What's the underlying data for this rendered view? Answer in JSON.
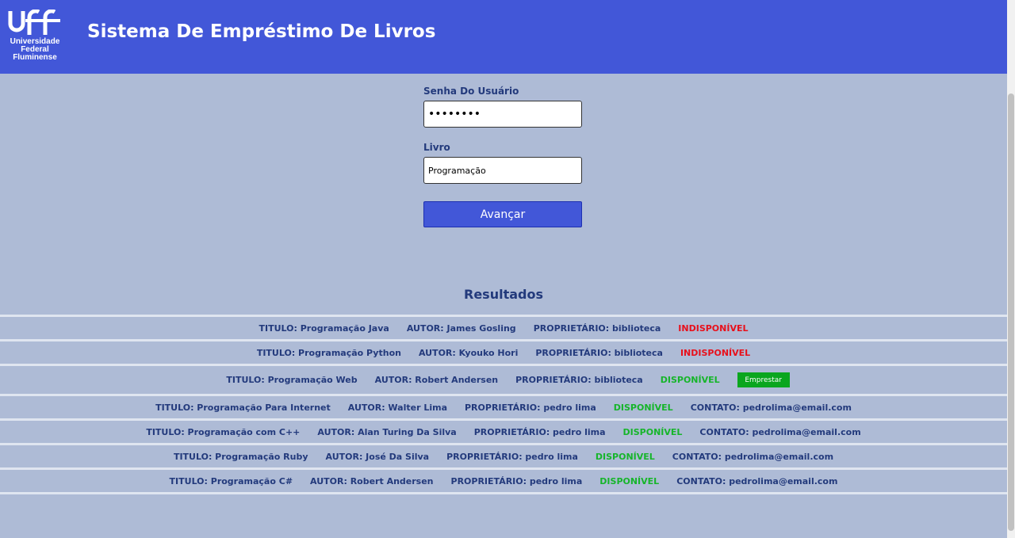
{
  "header": {
    "logo": {
      "text": "uff",
      "lines": [
        "Universidade",
        "Federal",
        "Fluminense"
      ]
    },
    "title": "Sistema De Empréstimo De Livros"
  },
  "form": {
    "password_label": "Senha Do Usuário",
    "password_value": "••••••••",
    "book_label": "Livro",
    "book_value": "Programação",
    "submit_label": "Avançar"
  },
  "results": {
    "title": "Resultados",
    "rows": [
      {
        "title": "TITULO: Programação Java",
        "author": "AUTOR: James Gosling",
        "owner": "PROPRIETÁRIO: biblioteca",
        "status": "INDISPONÍVEL",
        "available": false
      },
      {
        "title": "TITULO: Programação Python",
        "author": "AUTOR: Kyouko Hori",
        "owner": "PROPRIETÁRIO: biblioteca",
        "status": "INDISPONÍVEL",
        "available": false
      },
      {
        "title": "TITULO: Programação Web",
        "author": "AUTOR: Robert Andersen",
        "owner": "PROPRIETÁRIO: biblioteca",
        "status": "DISPONÍVEL",
        "available": true,
        "action": "Emprestar"
      },
      {
        "title": "TITULO: Programação Para Internet",
        "author": "AUTOR: Walter Lima",
        "owner": "PROPRIETÁRIO: pedro lima",
        "status": "DISPONÍVEL",
        "available": true,
        "contact": "CONTATO: pedrolima@email.com"
      },
      {
        "title": "TITULO: Programação com C++",
        "author": "AUTOR: Alan Turing Da Silva",
        "owner": "PROPRIETÁRIO: pedro lima",
        "status": "DISPONÍVEL",
        "available": true,
        "contact": "CONTATO: pedrolima@email.com"
      },
      {
        "title": "TITULO: Programação Ruby",
        "author": "AUTOR: José Da Silva",
        "owner": "PROPRIETÁRIO: pedro lima",
        "status": "DISPONÍVEL",
        "available": true,
        "contact": "CONTATO: pedrolima@email.com"
      },
      {
        "title": "TITULO: Programação C#",
        "author": "AUTOR: Robert Andersen",
        "owner": "PROPRIETÁRIO: pedro lima",
        "status": "DISPONÍVEL",
        "available": true,
        "contact": "CONTATO: pedrolima@email.com"
      }
    ]
  },
  "colors": {
    "header_bg": "#4257d8",
    "page_bg": "#aebbd6",
    "text": "#233a7c",
    "unavailable": "#e8101b",
    "available": "#16b52a",
    "lend_button": "#0aa61e"
  }
}
